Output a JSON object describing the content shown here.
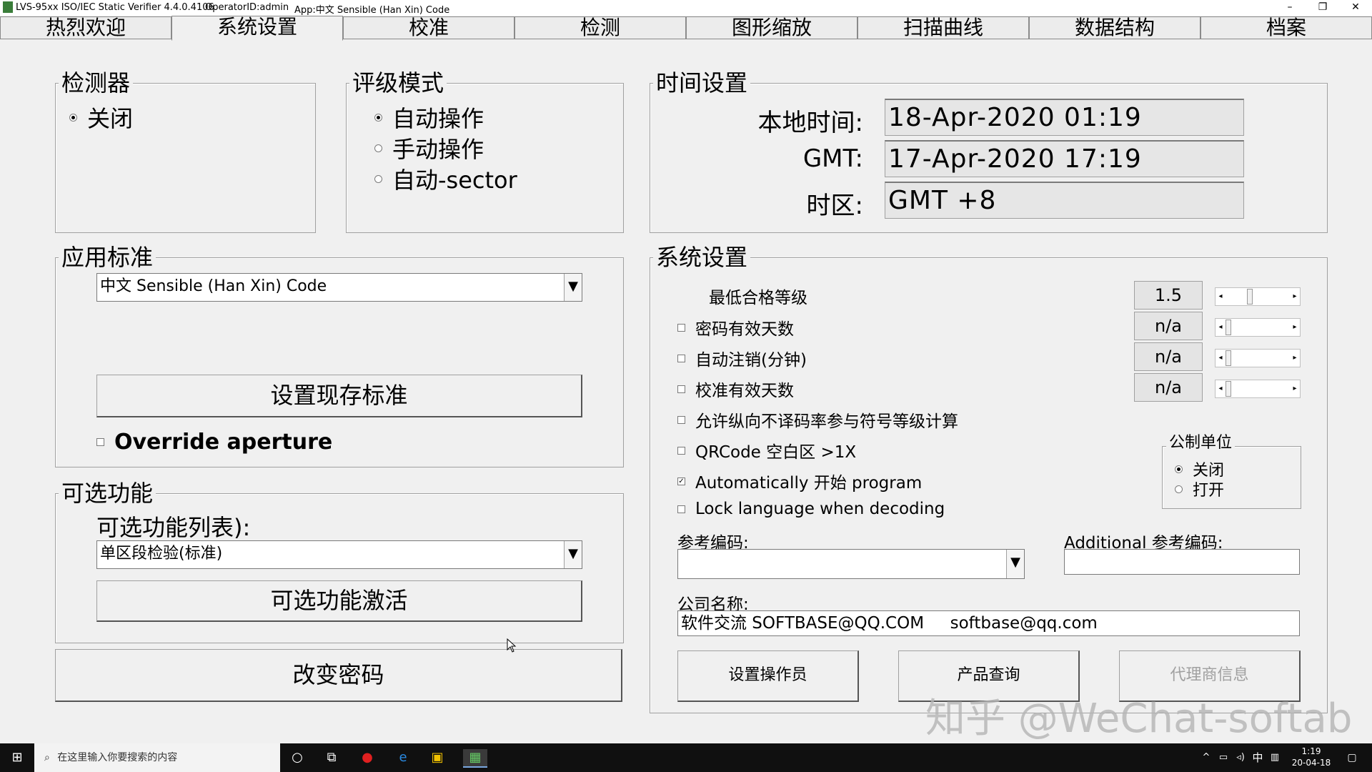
{
  "titlebar": {
    "app_name": "LVS-95xx ISO/IEC Static Verifier 4.4.0.4106",
    "operator": "OperatorID:admin",
    "app_code": "App:中文 Sensible (Han Xin) Code",
    "minimize": "–",
    "restore": "❐",
    "close": "✕"
  },
  "tabs": [
    "热烈欢迎",
    "系统设置",
    "校准",
    "检测",
    "图形缩放",
    "扫描曲线",
    "数据结构",
    "档案"
  ],
  "active_tab": 1,
  "detector": {
    "label": "检测器",
    "option": "关闭"
  },
  "grading_mode": {
    "label": "评级模式",
    "options": [
      "自动操作",
      "手动操作",
      "自动-sector"
    ],
    "selected": 0
  },
  "time_settings": {
    "label": "时间设置",
    "local_time_label": "本地时间:",
    "local_time": "18-Apr-2020 01:19",
    "gmt_label": "GMT:",
    "gmt": "17-Apr-2020 17:19",
    "tz_label": "时区:",
    "tz": "GMT +8"
  },
  "standard": {
    "label": "应用标准",
    "selected": "中文 Sensible (Han Xin) Code",
    "set_button": "设置现存标准",
    "override_label": "Override aperture"
  },
  "optional": {
    "label": "可选功能",
    "list_label": "可选功能列表):",
    "selected": "单区段检验(标准)",
    "activate_button": "可选功能激活"
  },
  "change_password": "改变密码",
  "system": {
    "label": "系统设置",
    "min_grade_label": "最低合格等级",
    "min_grade": "1.5",
    "password_days_label": "密码有效天数",
    "password_days": "n/a",
    "auto_logout_label": "自动注销(分钟)",
    "auto_logout": "n/a",
    "calib_days_label": "校准有效天数",
    "calib_days": "n/a",
    "allow_label": "允许纵向不译码率参与符号等级计算",
    "qr_label": "QRCode 空白区 >1X",
    "auto_start_label": "Automatically 开始 program",
    "lock_label": "Lock language when decoding",
    "metric_label": "公制单位",
    "metric_options": [
      "关闭",
      "打开"
    ],
    "ref_code_label": "参考编码:",
    "additional_ref_label": "Additional 参考编码:",
    "company_label": "公司名称:",
    "company_value": "软件交流 SOFTBASE@QQ.COM     softbase@qq.com",
    "set_operator": "设置操作员",
    "product_query": "产品查询",
    "agent_info": "代理商信息"
  },
  "watermark": "知乎 @WeChat-softab",
  "taskbar": {
    "search_placeholder": "在这里输入你要搜索的内容",
    "time": "1:19",
    "date": "20-04-18",
    "ime": "中"
  },
  "colors": {
    "background": "#f0f0f0",
    "field_bg": "#e6e6e6",
    "taskbar": "#101010"
  }
}
